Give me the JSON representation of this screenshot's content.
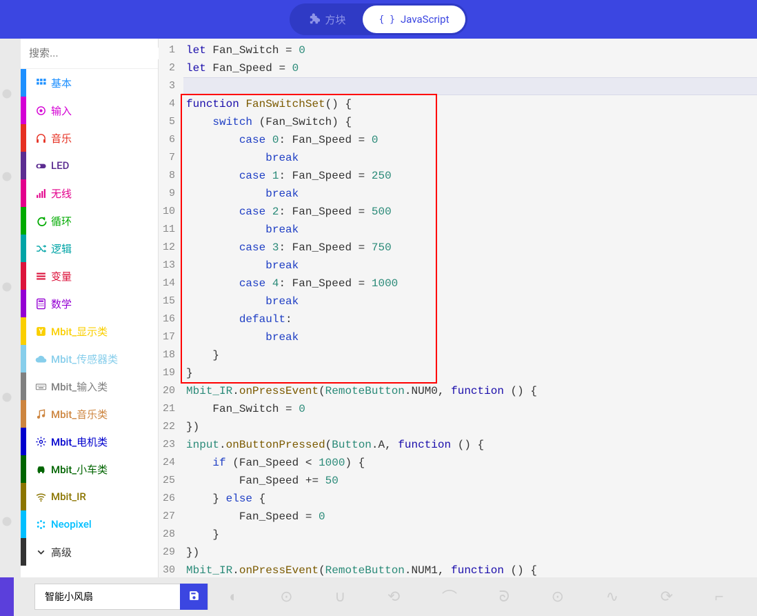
{
  "header": {
    "tabs": {
      "blocks": "方块",
      "javascript": "JavaScript"
    }
  },
  "search": {
    "placeholder": "搜索..."
  },
  "categories": [
    {
      "id": "basic",
      "label": "基本",
      "color": "#1E90FF",
      "iconColor": "#1E90FF",
      "icon": "grid"
    },
    {
      "id": "input",
      "label": "输入",
      "color": "#D400D4",
      "iconColor": "#D400D4",
      "icon": "target"
    },
    {
      "id": "music",
      "label": "音乐",
      "color": "#E63022",
      "iconColor": "#E63022",
      "icon": "headphones"
    },
    {
      "id": "led",
      "label": "LED",
      "color": "#5C2D91",
      "iconColor": "#5C2D91",
      "icon": "toggle"
    },
    {
      "id": "radio",
      "label": "无线",
      "color": "#E3008C",
      "iconColor": "#E3008C",
      "icon": "signal"
    },
    {
      "id": "loops",
      "label": "循环",
      "color": "#00AA00",
      "iconColor": "#00AA00",
      "icon": "loop"
    },
    {
      "id": "logic",
      "label": "逻辑",
      "color": "#00A4A6",
      "iconColor": "#00A4A6",
      "icon": "shuffle"
    },
    {
      "id": "variables",
      "label": "变量",
      "color": "#DC143C",
      "iconColor": "#DC143C",
      "icon": "list"
    },
    {
      "id": "math",
      "label": "数学",
      "color": "#9400D3",
      "iconColor": "#9400D3",
      "icon": "calc"
    },
    {
      "id": "mbit_display",
      "label": "Mbit_显示类",
      "color": "#FACF00",
      "iconColor": "#FACF00",
      "icon": "y"
    },
    {
      "id": "mbit_sensor",
      "label": "Mbit_传感器类",
      "color": "#87CEEB",
      "iconColor": "#87CEEB",
      "icon": "cloud"
    },
    {
      "id": "mbit_input",
      "label": "Mbit_输入类",
      "color": "#808080",
      "iconColor": "#808080",
      "icon": "keyboard"
    },
    {
      "id": "mbit_music",
      "label": "Mbit_音乐类",
      "color": "#CD853F",
      "iconColor": "#CD853F",
      "icon": "note"
    },
    {
      "id": "mbit_motor",
      "label": "Mbit_电机类",
      "color": "#0000CD",
      "iconColor": "#0000CD",
      "icon": "gear"
    },
    {
      "id": "mbit_car",
      "label": "Mbit_小车类",
      "color": "#006400",
      "iconColor": "#006400",
      "icon": "car"
    },
    {
      "id": "mbit_ir",
      "label": "Mbit_IR",
      "color": "#8B7500",
      "iconColor": "#8B7500",
      "icon": "wifi"
    },
    {
      "id": "neopixel",
      "label": "Neopixel",
      "color": "#00BFFF",
      "iconColor": "#00BFFF",
      "icon": "dots"
    },
    {
      "id": "advanced",
      "label": "高级",
      "color": "#333333",
      "iconColor": "#333333",
      "icon": "chevron"
    }
  ],
  "code": {
    "highlightLineIndex": 2,
    "redBox": {
      "startLine": 4,
      "endLine": 19
    },
    "lines": [
      {
        "n": 1,
        "tokens": [
          {
            "t": "let ",
            "c": "kw"
          },
          {
            "t": "Fan_Switch = ",
            "c": "id"
          },
          {
            "t": "0",
            "c": "num"
          }
        ]
      },
      {
        "n": 2,
        "tokens": [
          {
            "t": "let ",
            "c": "kw"
          },
          {
            "t": "Fan_Speed = ",
            "c": "id"
          },
          {
            "t": "0",
            "c": "num"
          }
        ]
      },
      {
        "n": 3,
        "tokens": []
      },
      {
        "n": 4,
        "tokens": [
          {
            "t": "function ",
            "c": "kw"
          },
          {
            "t": "FanSwitchSet",
            "c": "fn"
          },
          {
            "t": "() {",
            "c": "id"
          }
        ]
      },
      {
        "n": 5,
        "tokens": [
          {
            "t": "    ",
            "c": ""
          },
          {
            "t": "switch ",
            "c": "kw2"
          },
          {
            "t": "(Fan_Switch) {",
            "c": "id"
          }
        ]
      },
      {
        "n": 6,
        "tokens": [
          {
            "t": "        ",
            "c": ""
          },
          {
            "t": "case ",
            "c": "kw2"
          },
          {
            "t": "0",
            "c": "num"
          },
          {
            "t": ": Fan_Speed = ",
            "c": "id"
          },
          {
            "t": "0",
            "c": "num"
          }
        ]
      },
      {
        "n": 7,
        "tokens": [
          {
            "t": "            ",
            "c": ""
          },
          {
            "t": "break",
            "c": "kw2"
          }
        ]
      },
      {
        "n": 8,
        "tokens": [
          {
            "t": "        ",
            "c": ""
          },
          {
            "t": "case ",
            "c": "kw2"
          },
          {
            "t": "1",
            "c": "num"
          },
          {
            "t": ": Fan_Speed = ",
            "c": "id"
          },
          {
            "t": "250",
            "c": "num"
          }
        ]
      },
      {
        "n": 9,
        "tokens": [
          {
            "t": "            ",
            "c": ""
          },
          {
            "t": "break",
            "c": "kw2"
          }
        ]
      },
      {
        "n": 10,
        "tokens": [
          {
            "t": "        ",
            "c": ""
          },
          {
            "t": "case ",
            "c": "kw2"
          },
          {
            "t": "2",
            "c": "num"
          },
          {
            "t": ": Fan_Speed = ",
            "c": "id"
          },
          {
            "t": "500",
            "c": "num"
          }
        ]
      },
      {
        "n": 11,
        "tokens": [
          {
            "t": "            ",
            "c": ""
          },
          {
            "t": "break",
            "c": "kw2"
          }
        ]
      },
      {
        "n": 12,
        "tokens": [
          {
            "t": "        ",
            "c": ""
          },
          {
            "t": "case ",
            "c": "kw2"
          },
          {
            "t": "3",
            "c": "num"
          },
          {
            "t": ": Fan_Speed = ",
            "c": "id"
          },
          {
            "t": "750",
            "c": "num"
          }
        ]
      },
      {
        "n": 13,
        "tokens": [
          {
            "t": "            ",
            "c": ""
          },
          {
            "t": "break",
            "c": "kw2"
          }
        ]
      },
      {
        "n": 14,
        "tokens": [
          {
            "t": "        ",
            "c": ""
          },
          {
            "t": "case ",
            "c": "kw2"
          },
          {
            "t": "4",
            "c": "num"
          },
          {
            "t": ": Fan_Speed = ",
            "c": "id"
          },
          {
            "t": "1000",
            "c": "num"
          }
        ]
      },
      {
        "n": 15,
        "tokens": [
          {
            "t": "            ",
            "c": ""
          },
          {
            "t": "break",
            "c": "kw2"
          }
        ]
      },
      {
        "n": 16,
        "tokens": [
          {
            "t": "        ",
            "c": ""
          },
          {
            "t": "default",
            "c": "kw2"
          },
          {
            "t": ":",
            "c": "id"
          }
        ]
      },
      {
        "n": 17,
        "tokens": [
          {
            "t": "            ",
            "c": ""
          },
          {
            "t": "break",
            "c": "kw2"
          }
        ]
      },
      {
        "n": 18,
        "tokens": [
          {
            "t": "    }",
            "c": "id"
          }
        ]
      },
      {
        "n": 19,
        "tokens": [
          {
            "t": "}",
            "c": "id"
          }
        ]
      },
      {
        "n": 20,
        "tokens": [
          {
            "t": "Mbit_IR",
            "c": "cls"
          },
          {
            "t": ".",
            "c": "id"
          },
          {
            "t": "onPressEvent",
            "c": "fn"
          },
          {
            "t": "(",
            "c": "id"
          },
          {
            "t": "RemoteButton",
            "c": "cls"
          },
          {
            "t": ".NUM0, ",
            "c": "id"
          },
          {
            "t": "function ",
            "c": "kw"
          },
          {
            "t": "() {",
            "c": "id"
          }
        ]
      },
      {
        "n": 21,
        "tokens": [
          {
            "t": "    Fan_Switch = ",
            "c": "id"
          },
          {
            "t": "0",
            "c": "num"
          }
        ]
      },
      {
        "n": 22,
        "tokens": [
          {
            "t": "})",
            "c": "id"
          }
        ]
      },
      {
        "n": 23,
        "tokens": [
          {
            "t": "input",
            "c": "cls"
          },
          {
            "t": ".",
            "c": "id"
          },
          {
            "t": "onButtonPressed",
            "c": "fn"
          },
          {
            "t": "(",
            "c": "id"
          },
          {
            "t": "Button",
            "c": "cls"
          },
          {
            "t": ".A, ",
            "c": "id"
          },
          {
            "t": "function ",
            "c": "kw"
          },
          {
            "t": "() {",
            "c": "id"
          }
        ]
      },
      {
        "n": 24,
        "tokens": [
          {
            "t": "    ",
            "c": ""
          },
          {
            "t": "if ",
            "c": "kw2"
          },
          {
            "t": "(Fan_Speed < ",
            "c": "id"
          },
          {
            "t": "1000",
            "c": "num"
          },
          {
            "t": ") {",
            "c": "id"
          }
        ]
      },
      {
        "n": 25,
        "tokens": [
          {
            "t": "        Fan_Speed += ",
            "c": "id"
          },
          {
            "t": "50",
            "c": "num"
          }
        ]
      },
      {
        "n": 26,
        "tokens": [
          {
            "t": "    } ",
            "c": "id"
          },
          {
            "t": "else ",
            "c": "kw2"
          },
          {
            "t": "{",
            "c": "id"
          }
        ]
      },
      {
        "n": 27,
        "tokens": [
          {
            "t": "        Fan_Speed = ",
            "c": "id"
          },
          {
            "t": "0",
            "c": "num"
          }
        ]
      },
      {
        "n": 28,
        "tokens": [
          {
            "t": "    }",
            "c": "id"
          }
        ]
      },
      {
        "n": 29,
        "tokens": [
          {
            "t": "})",
            "c": "id"
          }
        ]
      },
      {
        "n": 30,
        "tokens": [
          {
            "t": "Mbit_IR",
            "c": "cls"
          },
          {
            "t": ".",
            "c": "id"
          },
          {
            "t": "onPressEvent",
            "c": "fn"
          },
          {
            "t": "(",
            "c": "id"
          },
          {
            "t": "RemoteButton",
            "c": "cls"
          },
          {
            "t": ".NUM1, ",
            "c": "id"
          },
          {
            "t": "function ",
            "c": "kw"
          },
          {
            "t": "() {",
            "c": "id"
          }
        ]
      }
    ]
  },
  "bottomBar": {
    "projectName": "智能小风扇"
  }
}
